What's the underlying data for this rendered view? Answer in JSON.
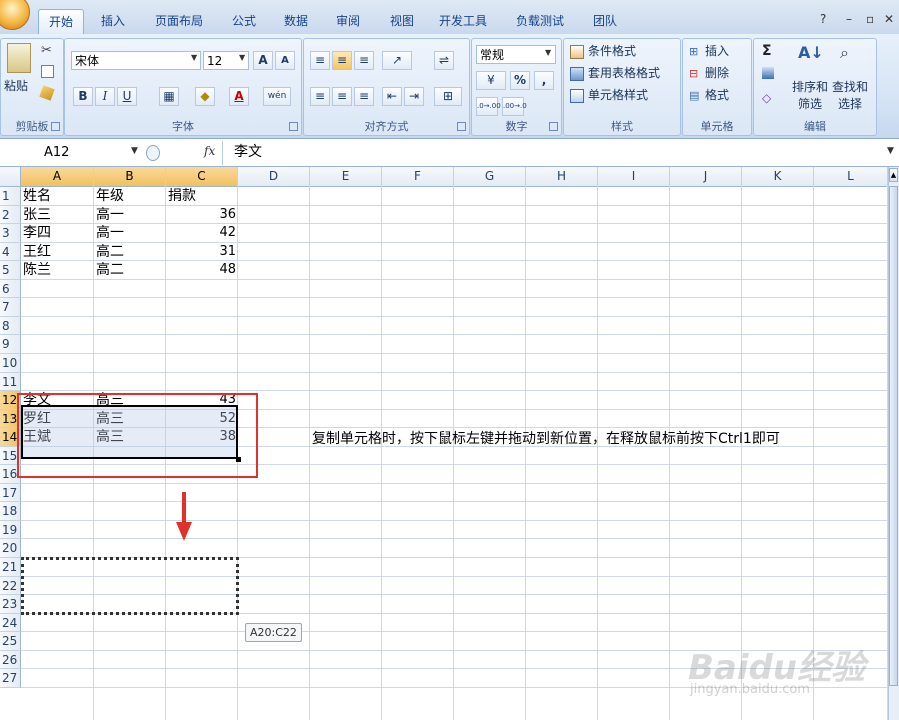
{
  "ribbon": {
    "tabs": [
      "开始",
      "插入",
      "页面布局",
      "公式",
      "数据",
      "审阅",
      "视图",
      "开发工具",
      "负载测试",
      "团队"
    ],
    "clipboard": {
      "paste": "粘贴",
      "label": "剪贴板"
    },
    "font": {
      "name": "宋体",
      "size": "12",
      "label": "字体",
      "bold": "B",
      "italic": "I",
      "underline": "U",
      "grow": "A",
      "shrink": "A",
      "font_color": "A",
      "phonetic": "wén"
    },
    "alignment": {
      "label": "对齐方式"
    },
    "number": {
      "format": "常规",
      "percent": "%",
      "comma": ",",
      "label": "数字",
      "inc_decimal": ".0→.00",
      "dec_decimal": ".00→.0"
    },
    "styles": {
      "conditional": "条件格式",
      "table": "套用表格格式",
      "cell_styles": "单元格样式",
      "label": "样式"
    },
    "cells": {
      "insert": "插入",
      "delete": "删除",
      "format": "格式",
      "label": "单元格"
    },
    "editing": {
      "sort": "排序和\n筛选",
      "find": "查找和\n选择",
      "label": "编辑",
      "sigma": "Σ"
    }
  },
  "formula_bar": {
    "name_box": "A12",
    "fx": "fx",
    "content": "李文"
  },
  "columns": [
    "A",
    "B",
    "C",
    "D",
    "E",
    "F",
    "G",
    "H",
    "I",
    "J",
    "K",
    "L"
  ],
  "rows": [
    "1",
    "2",
    "3",
    "4",
    "5",
    "6",
    "7",
    "8",
    "9",
    "10",
    "11",
    "12",
    "13",
    "14",
    "15",
    "16",
    "17",
    "18",
    "19",
    "20",
    "21",
    "22",
    "23",
    "24",
    "25",
    "26",
    "27"
  ],
  "data_top": [
    [
      "姓名",
      "年级",
      "捐款"
    ],
    [
      "张三",
      "高一",
      "36"
    ],
    [
      "李四",
      "高一",
      "42"
    ],
    [
      "王红",
      "高二",
      "31"
    ],
    [
      "陈兰",
      "高二",
      "48"
    ]
  ],
  "data_sel": [
    [
      "李文",
      "高三",
      "43"
    ],
    [
      "罗红",
      "高三",
      "52"
    ],
    [
      "王斌",
      "高三",
      "38"
    ]
  ],
  "note": "复制单元格时，按下鼠标左键并拖动到新位置，在释放鼠标前按下Ctrl1即可",
  "drag_tooltip": "A20:C22",
  "watermark": {
    "brand": "Baidu经验",
    "url": "jingyan.baidu.com"
  },
  "colors": {
    "selection_border": "#e0322c",
    "arrow": "#e0322c",
    "header_selected": "#f1c15f"
  }
}
